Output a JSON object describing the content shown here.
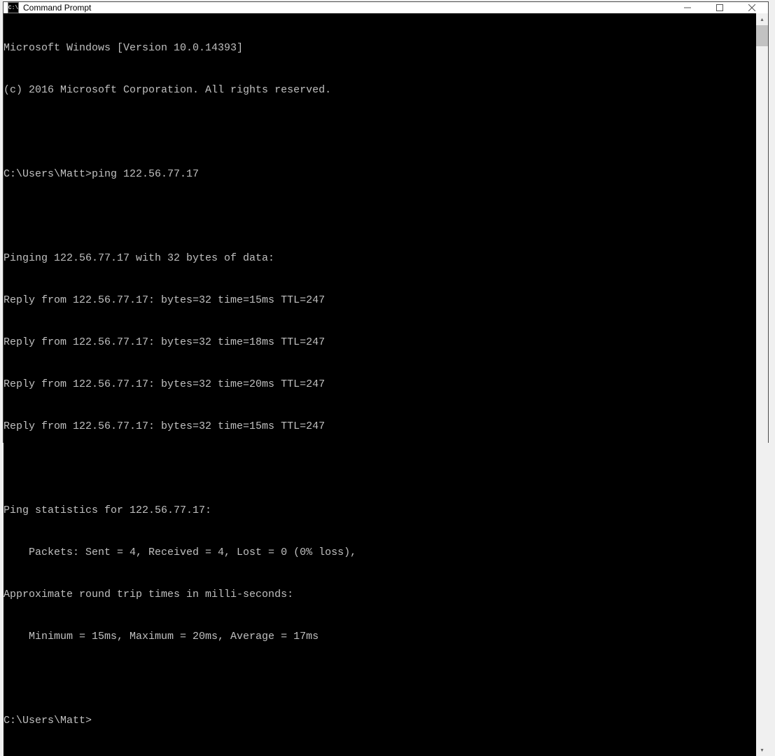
{
  "window": {
    "title": "Command Prompt",
    "icon_text": "C:\\"
  },
  "console": {
    "lines": [
      "Microsoft Windows [Version 10.0.14393]",
      "(c) 2016 Microsoft Corporation. All rights reserved.",
      "",
      "C:\\Users\\Matt>ping 122.56.77.17",
      "",
      "Pinging 122.56.77.17 with 32 bytes of data:",
      "Reply from 122.56.77.17: bytes=32 time=15ms TTL=247",
      "Reply from 122.56.77.17: bytes=32 time=18ms TTL=247",
      "Reply from 122.56.77.17: bytes=32 time=20ms TTL=247",
      "Reply from 122.56.77.17: bytes=32 time=15ms TTL=247",
      "",
      "Ping statistics for 122.56.77.17:",
      "    Packets: Sent = 4, Received = 4, Lost = 0 (0% loss),",
      "Approximate round trip times in milli-seconds:",
      "    Minimum = 15ms, Maximum = 20ms, Average = 17ms",
      "",
      "C:\\Users\\Matt>"
    ]
  }
}
